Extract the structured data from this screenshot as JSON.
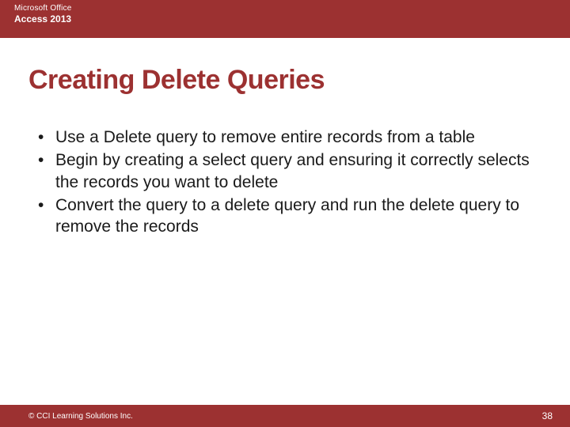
{
  "header": {
    "product_line": "Microsoft Office",
    "app_line": "Access 2013"
  },
  "title": "Creating Delete Queries",
  "bullets": [
    "Use a Delete query to remove entire records from a table",
    "Begin by creating a select query and ensuring it correctly selects the records you want to delete",
    "Convert the query to a delete query and run the delete query to remove the records"
  ],
  "footer": {
    "copyright": "© CCI Learning Solutions Inc.",
    "page": "38"
  },
  "colors": {
    "brand": "#9c3131",
    "text": "#1a1a1a",
    "background": "#ffffff"
  }
}
